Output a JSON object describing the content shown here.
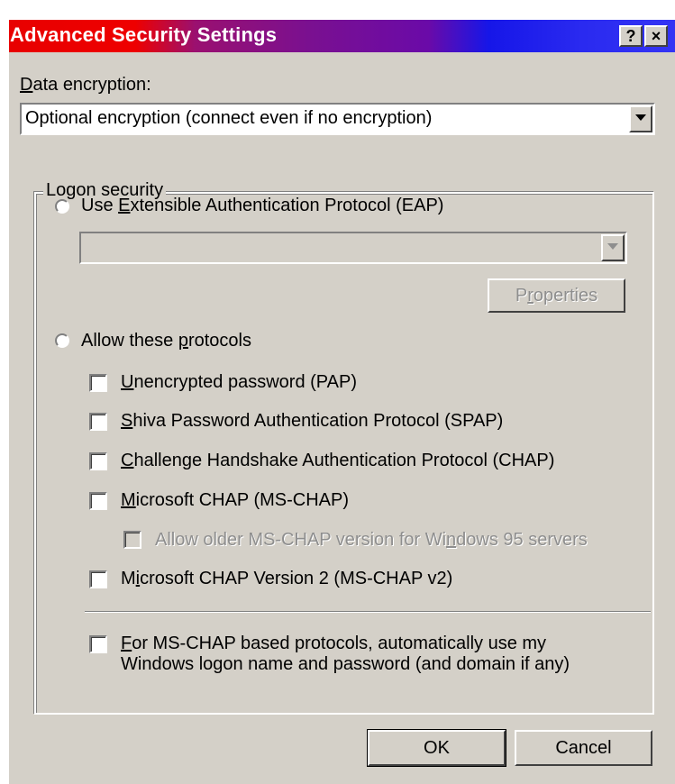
{
  "window": {
    "title": "Advanced Security Settings",
    "help_button": "?",
    "close_button": "×"
  },
  "data_encryption": {
    "label": "Data encryption:",
    "selected": "Optional encryption (connect even if no encryption)"
  },
  "logon_security": {
    "group_label": "Logon security",
    "eap": {
      "label": "Use Extensible Authentication Protocol (EAP)",
      "selected": "",
      "properties_button": "Properties",
      "checked": false
    },
    "protocols": {
      "label": "Allow these protocols",
      "checked": false,
      "items": [
        {
          "label": "Unencrypted password (PAP)",
          "checked": false,
          "enabled": true
        },
        {
          "label": "Shiva Password Authentication Protocol (SPAP)",
          "checked": false,
          "enabled": true
        },
        {
          "label": "Challenge Handshake Authentication Protocol (CHAP)",
          "checked": false,
          "enabled": true
        },
        {
          "label": "Microsoft CHAP (MS-CHAP)",
          "checked": false,
          "enabled": true
        },
        {
          "label": "Allow older MS-CHAP version for Windows 95 servers",
          "checked": false,
          "enabled": false
        },
        {
          "label": "Microsoft CHAP Version 2 (MS-CHAP v2)",
          "checked": false,
          "enabled": true
        }
      ]
    },
    "auto_logon": {
      "line1": "For MS-CHAP based protocols, automatically use my",
      "line2": "Windows logon name and password (and domain if any)",
      "checked": false
    }
  },
  "buttons": {
    "ok": "OK",
    "cancel": "Cancel"
  },
  "colors": {
    "dialog_face": "#d4d0c8",
    "title_start": "#e80000",
    "title_end": "#3434f4",
    "disabled_text": "#8e8e8e"
  }
}
